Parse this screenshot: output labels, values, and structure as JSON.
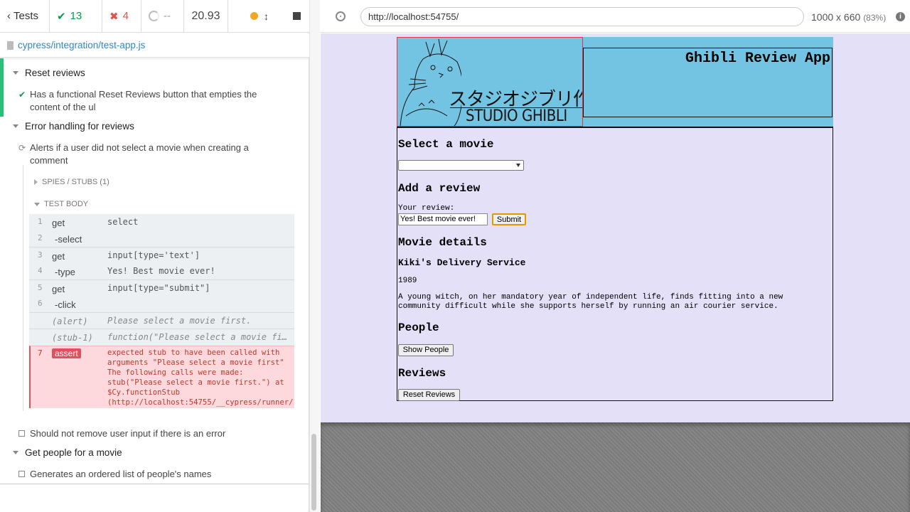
{
  "reporter": {
    "header": {
      "tests_label": "Tests",
      "passed": "13",
      "failed": "4",
      "pending": "--",
      "duration": "20.93"
    },
    "spec_path": "cypress/integration/test-app.js",
    "suites": [
      {
        "title": "Reset reviews",
        "tests": [
          {
            "title": "Has a functional Reset Reviews button that empties the content of the ul",
            "state": "passed"
          }
        ]
      },
      {
        "title": "Error handling for reviews",
        "tests": [
          {
            "title": "Alerts if a user did not select a movie when creating a comment",
            "state": "running",
            "spies_label": "SPIES / STUBS (1)",
            "body_label": "TEST BODY",
            "commands": [
              {
                "num": "1",
                "name": "get",
                "message": "select"
              },
              {
                "num": "2",
                "name": "-select",
                "message": ""
              },
              {
                "num": "3",
                "name": "get",
                "message": "input[type='text']"
              },
              {
                "num": "4",
                "name": "-type",
                "message": "Yes! Best movie ever!"
              },
              {
                "num": "5",
                "name": "get",
                "message": "input[type=\"submit\"]"
              },
              {
                "num": "6",
                "name": "-click",
                "message": ""
              },
              {
                "num": "",
                "name": "(alert)",
                "message": "Please select a movie first."
              },
              {
                "num": "",
                "name": "(stub-1)",
                "message": "function(\"Please select a movie fi…"
              }
            ],
            "error": {
              "num": "7",
              "badge": "assert",
              "message": "expected stub to have been called with\narguments \"Please select a movie first\"\nThe following calls were made:\nstub(\"Please select a movie first.\") at\n$Cy.functionStub\n(http://localhost:54755/__cypress/runner/…"
            }
          },
          {
            "title": "Should not remove user input if there is an error",
            "state": "pending"
          }
        ]
      },
      {
        "title": "Get people for a movie",
        "tests": [
          {
            "title": "Generates an ordered list of people's names",
            "state": "pending"
          }
        ]
      }
    ]
  },
  "aut_bar": {
    "url": "http://localhost:54755/",
    "viewport": "1000 x 660",
    "scale": "(83%)"
  },
  "app": {
    "logo_jp": "スタジオジブリ作品",
    "logo_en": "STUDIO GHIBLI",
    "title": "Ghibli Review App",
    "select_heading": "Select a movie",
    "select_value": "",
    "add_heading": "Add a review",
    "review_label": "Your review:",
    "review_value": "Yes! Best movie ever!",
    "submit_label": "Submit",
    "details_heading": "Movie details",
    "movie_title": "Kiki's Delivery Service",
    "movie_year": "1989",
    "movie_description": "A young witch, on her mandatory year of independent life, finds fitting into a new community difficult while she supports herself by running an air courier service.",
    "people_heading": "People",
    "show_people_label": "Show People",
    "reviews_heading": "Reviews",
    "reset_reviews_label": "Reset Reviews"
  },
  "colors": {
    "pass": "#0b9a4b",
    "fail": "#d9534f",
    "header_blue": "#72c4e2",
    "page_lavender": "#e3e0f8"
  }
}
